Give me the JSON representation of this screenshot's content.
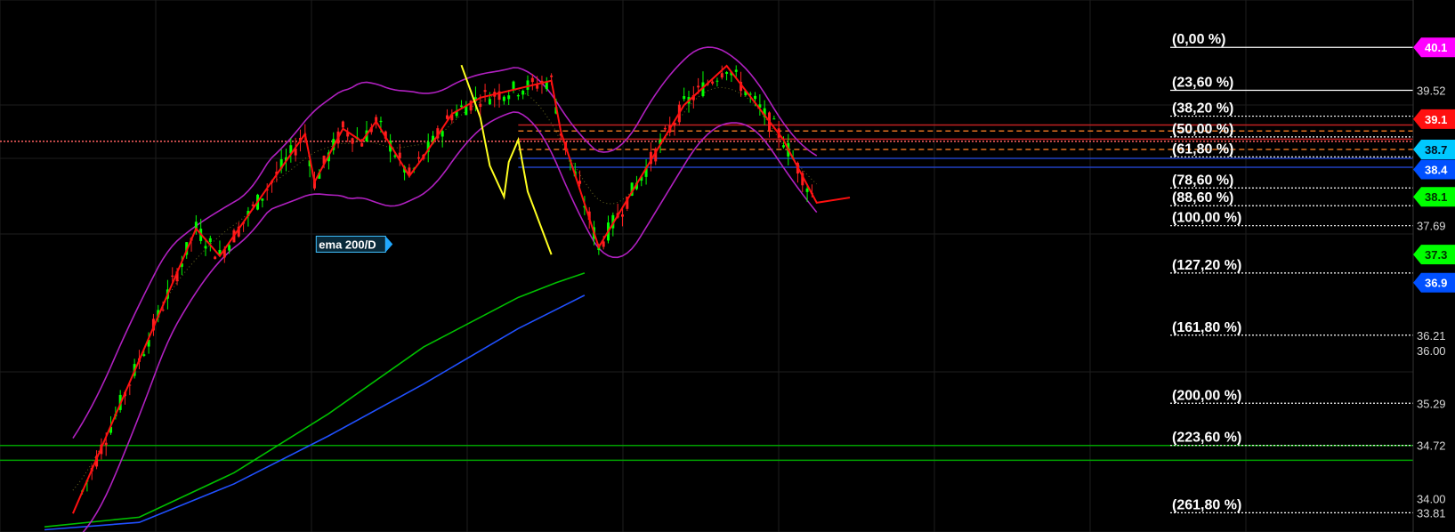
{
  "chart_data": {
    "type": "candlestick",
    "background": "#000000",
    "grid": true,
    "ylim": [
      33.55,
      40.74
    ],
    "xlim": [
      0,
      170
    ],
    "fibonacci": {
      "levels": [
        {
          "label": "(0,00 %)",
          "price": 40.1,
          "style": "solid"
        },
        {
          "label": "(23,60 %)",
          "price": 39.52,
          "style": "solid"
        },
        {
          "label": "(38,20 %)",
          "price": 39.17,
          "style": "dotted"
        },
        {
          "label": "(50,00 %)",
          "price": 38.89,
          "style": "dotted"
        },
        {
          "label": "(61,80 %)",
          "price": 38.62,
          "style": "dotted"
        },
        {
          "label": "(78,60 %)",
          "price": 38.2,
          "style": "dotted"
        },
        {
          "label": "(88,60 %)",
          "price": 37.96,
          "style": "dotted"
        },
        {
          "label": "(100,00 %)",
          "price": 37.69,
          "style": "dotted"
        },
        {
          "label": "(127,20 %)",
          "price": 37.05,
          "style": "dotted"
        },
        {
          "label": "(161,80 %)",
          "price": 36.21,
          "style": "dotted"
        },
        {
          "label": "(200,00 %)",
          "price": 35.29,
          "style": "dotted"
        },
        {
          "label": "(223,60 %)",
          "price": 34.72,
          "style": "dotted"
        },
        {
          "label": "(261,80 %)",
          "price": 33.81,
          "style": "dotted"
        }
      ]
    },
    "price_axis": {
      "plain_labels": [
        {
          "text": "39.52",
          "price": 39.52
        },
        {
          "text": "37.69",
          "price": 37.69
        },
        {
          "text": "36.21",
          "price": 36.21
        },
        {
          "text": "36.00",
          "price": 36.0
        },
        {
          "text": "35.29",
          "price": 35.29
        },
        {
          "text": "34.72",
          "price": 34.72
        },
        {
          "text": "34.00",
          "price": 34.0
        },
        {
          "text": "33.81",
          "price": 33.81
        }
      ],
      "badges": [
        {
          "text": "40.1",
          "price": 40.1,
          "color": "#ff00ff",
          "text_color": "#ffffff"
        },
        {
          "text": "39.1",
          "price": 39.13,
          "color": "#ff1010",
          "text_color": "#ffffff"
        },
        {
          "text": "38.7",
          "price": 38.72,
          "color": "#00c8ff",
          "text_color": "#001020"
        },
        {
          "text": "38.4",
          "price": 38.45,
          "color": "#0050ff",
          "text_color": "#ffffff"
        },
        {
          "text": "38.1",
          "price": 38.08,
          "color": "#00ff00",
          "text_color": "#003000"
        },
        {
          "text": "37.3",
          "price": 37.3,
          "color": "#00ff00",
          "text_color": "#003000"
        },
        {
          "text": "36.9",
          "price": 36.92,
          "color": "#0050ff",
          "text_color": "#ffffff"
        }
      ]
    },
    "horizontal_lines": [
      {
        "price": 38.83,
        "color": "#ff6060",
        "style": "dotted",
        "from_x": 0
      },
      {
        "price": 39.05,
        "color": "#c02020",
        "style": "solid",
        "from_x": 100
      },
      {
        "price": 38.97,
        "color": "#e07020",
        "style": "dashed",
        "from_x": 100
      },
      {
        "price": 38.86,
        "color": "#c02020",
        "style": "solid",
        "from_x": 100
      },
      {
        "price": 38.72,
        "color": "#e07020",
        "style": "dashed",
        "from_x": 100
      },
      {
        "price": 38.6,
        "color": "#2040c0",
        "style": "solid",
        "from_x": 100
      },
      {
        "price": 38.48,
        "color": "#2040c0",
        "style": "solid",
        "from_x": 100
      },
      {
        "price": 34.72,
        "color": "#00a000",
        "style": "solid",
        "from_x": 0
      },
      {
        "price": 34.52,
        "color": "#00a000",
        "style": "solid",
        "from_x": 0
      }
    ],
    "annotations": [
      {
        "text": "ema 200/D",
        "x": 72,
        "price": 37.44
      }
    ],
    "pattern_lines": {
      "red_zigzag": [
        [
          6,
          33.8
        ],
        [
          32,
          37.65
        ],
        [
          37,
          37.28
        ],
        [
          55,
          38.93
        ],
        [
          57,
          38.28
        ],
        [
          63,
          39.0
        ],
        [
          67,
          38.83
        ],
        [
          70,
          39.1
        ],
        [
          77,
          38.36
        ],
        [
          80,
          38.62
        ],
        [
          86,
          39.2
        ],
        [
          92,
          39.42
        ],
        [
          107,
          39.65
        ],
        [
          109,
          38.96
        ],
        [
          117,
          37.4
        ],
        [
          135,
          39.32
        ],
        [
          144,
          39.85
        ],
        [
          156,
          38.85
        ],
        [
          157,
          38.72
        ],
        [
          163,
          38.0
        ],
        [
          170,
          38.07
        ]
      ],
      "yellow_forecast": [
        [
          88,
          39.86
        ],
        [
          92,
          39.15
        ],
        [
          94,
          38.5
        ],
        [
          97,
          38.08
        ],
        [
          98,
          38.55
        ],
        [
          100,
          38.85
        ],
        [
          102,
          38.15
        ],
        [
          107,
          37.3
        ]
      ]
    },
    "moving_averages": [
      {
        "color": "#00c000",
        "points": [
          [
            0,
            33.62
          ],
          [
            20,
            33.75
          ],
          [
            40,
            34.35
          ],
          [
            60,
            35.15
          ],
          [
            80,
            36.05
          ],
          [
            100,
            36.72
          ],
          [
            108,
            36.92
          ],
          [
            114,
            37.05
          ]
        ]
      },
      {
        "color": "#2050ff",
        "points": [
          [
            0,
            33.58
          ],
          [
            20,
            33.68
          ],
          [
            40,
            34.2
          ],
          [
            60,
            34.85
          ],
          [
            80,
            35.55
          ],
          [
            100,
            36.3
          ],
          [
            114,
            36.75
          ]
        ]
      }
    ]
  }
}
